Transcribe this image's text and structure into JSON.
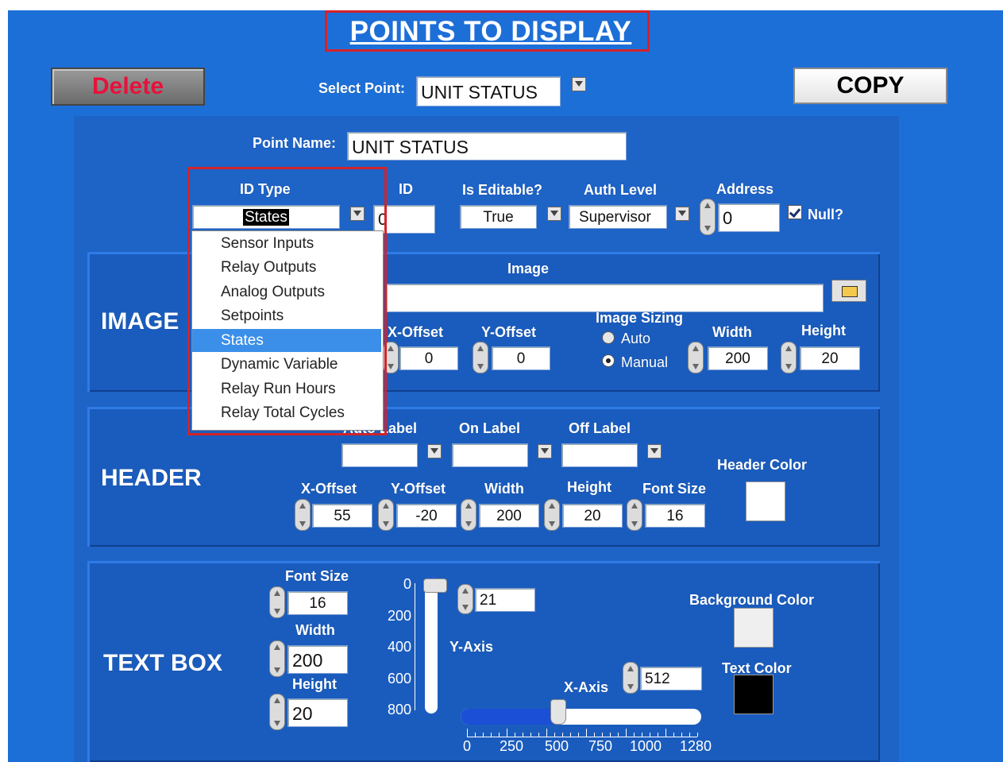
{
  "title": "POINTS TO DISPLAY",
  "toolbar": {
    "delete_label": "Delete",
    "copy_label": "COPY",
    "select_point_label": "Select Point:",
    "select_point_value": "UNIT STATUS"
  },
  "point": {
    "name_label": "Point Name:",
    "name_value": "UNIT STATUS",
    "id_type_label": "ID Type",
    "id_type_value": "States",
    "id_label": "ID",
    "id_value": "0",
    "is_editable_label": "Is Editable?",
    "is_editable_value": "True",
    "auth_level_label": "Auth Level",
    "auth_level_value": "Supervisor",
    "address_label": "Address",
    "address_value": "0",
    "null_label": "Null?",
    "null_checked": true
  },
  "id_type_options": [
    "Sensor Inputs",
    "Relay Outputs",
    "Analog Outputs",
    "Setpoints",
    "States",
    "Dynamic Variable",
    "Relay Run Hours",
    "Relay Total Cycles"
  ],
  "id_type_selected_index": 4,
  "image_section": {
    "title": "IMAGE",
    "image_label": "Image",
    "image_value": "",
    "x_offset_label": "X-Offset",
    "x_offset_value": "0",
    "y_offset_label": "Y-Offset",
    "y_offset_value": "0",
    "sizing_label": "Image Sizing",
    "sizing_auto": "Auto",
    "sizing_manual": "Manual",
    "sizing_selected": "Manual",
    "width_label": "Width",
    "width_value": "200",
    "height_label": "Height",
    "height_value": "20"
  },
  "header_section": {
    "title": "HEADER",
    "auto_label": "Auto Label",
    "on_label": "On Label",
    "off_label": "Off Label",
    "header_color_label": "Header Color",
    "header_color": "#ffffff",
    "x_offset_label": "X-Offset",
    "x_offset_value": "55",
    "y_offset_label": "Y-Offset",
    "y_offset_value": "-20",
    "width_label": "Width",
    "width_value": "200",
    "height_label": "Height",
    "height_value": "20",
    "font_size_label": "Font Size",
    "font_size_value": "16"
  },
  "textbox_section": {
    "title": "TEXT BOX",
    "font_size_label": "Font Size",
    "font_size_value": "16",
    "width_label": "Width",
    "width_value": "200",
    "height_label": "Height",
    "height_value": "20",
    "y_axis_label": "Y-Axis",
    "y_axis_value": "21",
    "y_axis_ticks": [
      "0",
      "200",
      "400",
      "600",
      "800"
    ],
    "x_axis_label": "X-Axis",
    "x_axis_value": "512",
    "x_axis_ticks": [
      "0",
      "250",
      "500",
      "750",
      "1000",
      "1280"
    ],
    "background_color_label": "Background Color",
    "background_color": "#efefef",
    "text_color_label": "Text Color",
    "text_color": "#000000"
  },
  "colors": {
    "background": "#1d6fd8",
    "highlight_red": "#d2232a",
    "delete_text": "#e8113b"
  }
}
